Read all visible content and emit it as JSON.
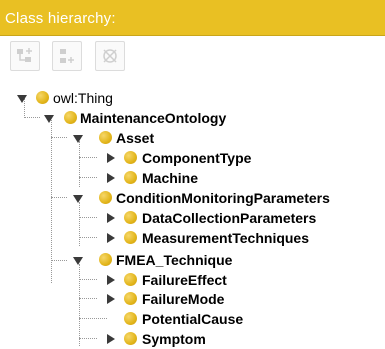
{
  "panel": {
    "title": "Class hierarchy:"
  },
  "toolbar": {
    "add_subclass_icon": "add-subclass-icon",
    "add_sibling_icon": "add-sibling-icon",
    "delete_icon": "delete-class-icon"
  },
  "tree": {
    "root": "owl:Thing",
    "maintenance": "MaintenanceOntology",
    "asset": "Asset",
    "component_type": "ComponentType",
    "machine": "Machine",
    "cm_params": "ConditionMonitoringParameters",
    "data_collection": "DataCollectionParameters",
    "measurement": "MeasurementTechniques",
    "fmea": "FMEA_Technique",
    "failure_effect": "FailureEffect",
    "failure_mode": "FailureMode",
    "potential_cause": "PotentialCause",
    "symptom": "Symptom"
  },
  "colors": {
    "header_bg": "#e9c023",
    "class_dot": "#e2b51b"
  }
}
